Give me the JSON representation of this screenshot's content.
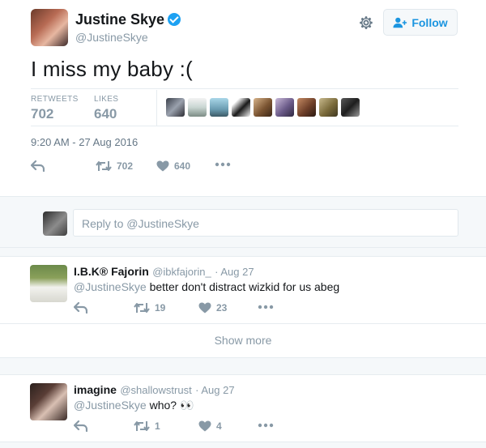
{
  "tweet": {
    "author_name": "Justine Skye",
    "author_handle": "@JustineSkye",
    "text": "I miss my baby :(",
    "retweets_label": "RETWEETS",
    "retweets_count": "702",
    "likes_label": "LIKES",
    "likes_count": "640",
    "timestamp": "9:20 AM - 27 Aug 2016",
    "actions": {
      "retweet_count": "702",
      "like_count": "640"
    }
  },
  "header": {
    "follow_label": "Follow"
  },
  "reply_box": {
    "placeholder": "Reply to @JustineSkye"
  },
  "replies": [
    {
      "name": "I.B.K® Fajorin",
      "handle": "@ibkfajorin_",
      "date": "· Aug 27",
      "mention": "@JustineSkye",
      "text": " better don't distract wizkid for us abeg",
      "retweet_count": "19",
      "like_count": "23"
    },
    {
      "name": "imagine",
      "handle": "@shallowstrust",
      "date": "· Aug 27",
      "mention": "@JustineSkye",
      "text": " who? 👀",
      "retweet_count": "1",
      "like_count": "4"
    }
  ],
  "show_more_label": "Show more",
  "colors": {
    "accent": "#1da1f2",
    "muted": "#8899a6",
    "divider": "#e6ecf0"
  },
  "icons": [
    "verified-icon",
    "gear-icon",
    "follow-person-icon",
    "reply-icon",
    "retweet-icon",
    "heart-icon",
    "more-icon"
  ]
}
